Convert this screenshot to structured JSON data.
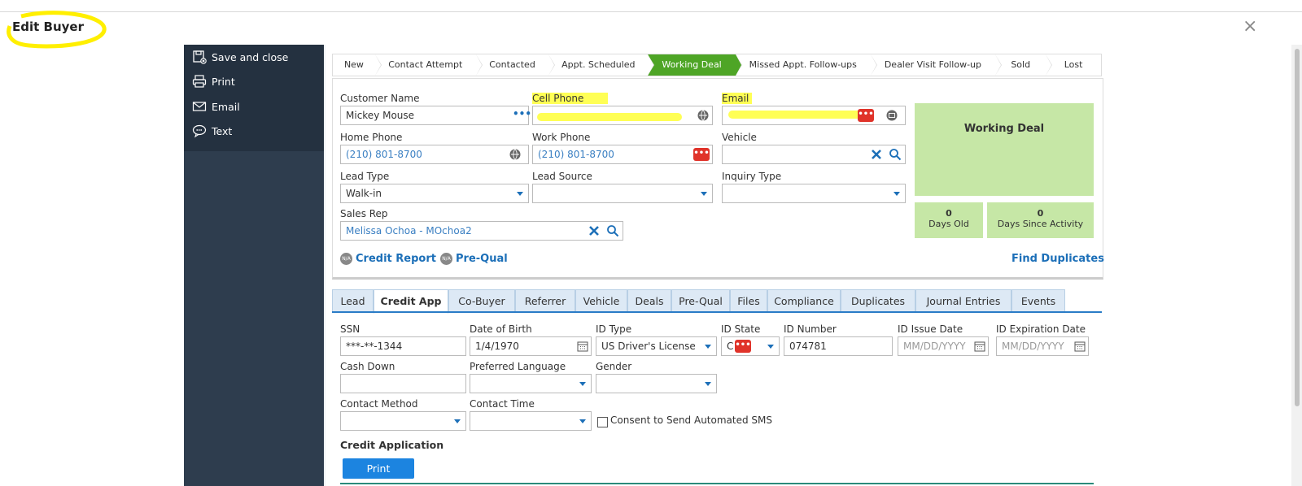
{
  "window": {
    "title": "Edit Buyer",
    "close_glyph": "×"
  },
  "sidebar": {
    "items": [
      {
        "label": "Save and close",
        "icon": "save-close-icon"
      },
      {
        "label": "Print",
        "icon": "printer-icon"
      },
      {
        "label": "Email",
        "icon": "envelope-icon"
      },
      {
        "label": "Text",
        "icon": "sms-icon"
      }
    ]
  },
  "pipeline": {
    "steps": [
      "New",
      "Contact Attempt",
      "Contacted",
      "Appt. Scheduled",
      "Working Deal",
      "Missed Appt. Follow-ups",
      "Dealer Visit Follow-up",
      "Sold",
      "Lost"
    ],
    "active": "Working Deal"
  },
  "form": {
    "customer_name": {
      "label": "Customer Name",
      "value": "Mickey Mouse"
    },
    "cell_phone": {
      "label": "Cell Phone",
      "value": ""
    },
    "email": {
      "label": "Email",
      "value": ""
    },
    "home_phone": {
      "label": "Home Phone",
      "value": "(210) 801-8700"
    },
    "work_phone": {
      "label": "Work Phone",
      "value": "(210) 801-8700"
    },
    "vehicle": {
      "label": "Vehicle",
      "value": ""
    },
    "lead_type": {
      "label": "Lead Type",
      "value": "Walk-in"
    },
    "lead_source": {
      "label": "Lead Source",
      "value": ""
    },
    "inquiry_type": {
      "label": "Inquiry Type",
      "value": ""
    },
    "sales_rep": {
      "label": "Sales Rep",
      "value": "Melissa Ochoa - MOchoa2"
    },
    "credit_report": "Credit Report",
    "pre_qual": "Pre-Qual",
    "na_badge": "N/A",
    "find_duplicates": "Find Duplicates",
    "more_badge": "•••"
  },
  "status": {
    "title": "Working Deal",
    "days_old": {
      "value": "0",
      "label": "Days Old"
    },
    "days_since_activity": {
      "value": "0",
      "label": "Days Since Activity"
    }
  },
  "tabs": [
    "Lead",
    "Credit App",
    "Co-Buyer",
    "Referrer",
    "Vehicle",
    "Deals",
    "Pre-Qual",
    "Files",
    "Compliance",
    "Duplicates",
    "Journal Entries",
    "Events"
  ],
  "active_tab": "Credit App",
  "credit_app": {
    "ssn": {
      "label": "SSN",
      "value": "***-**-1344"
    },
    "dob": {
      "label": "Date of Birth",
      "value": "1/4/1970"
    },
    "id_type": {
      "label": "ID Type",
      "value": "US Driver's License"
    },
    "id_state": {
      "label": "ID State",
      "value": "C"
    },
    "id_number": {
      "label": "ID Number",
      "value": "074781"
    },
    "id_issue_date": {
      "label": "ID Issue Date",
      "placeholder": "MM/DD/YYYY"
    },
    "id_expiration_date": {
      "label": "ID Expiration Date",
      "placeholder": "MM/DD/YYYY"
    },
    "cash_down": {
      "label": "Cash Down",
      "value": ""
    },
    "preferred_language": {
      "label": "Preferred Language",
      "value": ""
    },
    "gender": {
      "label": "Gender",
      "value": ""
    },
    "contact_method": {
      "label": "Contact Method",
      "value": ""
    },
    "contact_time": {
      "label": "Contact Time",
      "value": ""
    },
    "consent_sms": "Consent to Send Automated SMS",
    "section_title": "Credit Application",
    "print_label": "Print"
  },
  "colors": {
    "active_step": "#4ea526",
    "highlight": "#ffff55",
    "accent": "#1c6fb8",
    "status_bg": "#c6e7a6",
    "sidebar_bg": "#2e3d4e"
  }
}
